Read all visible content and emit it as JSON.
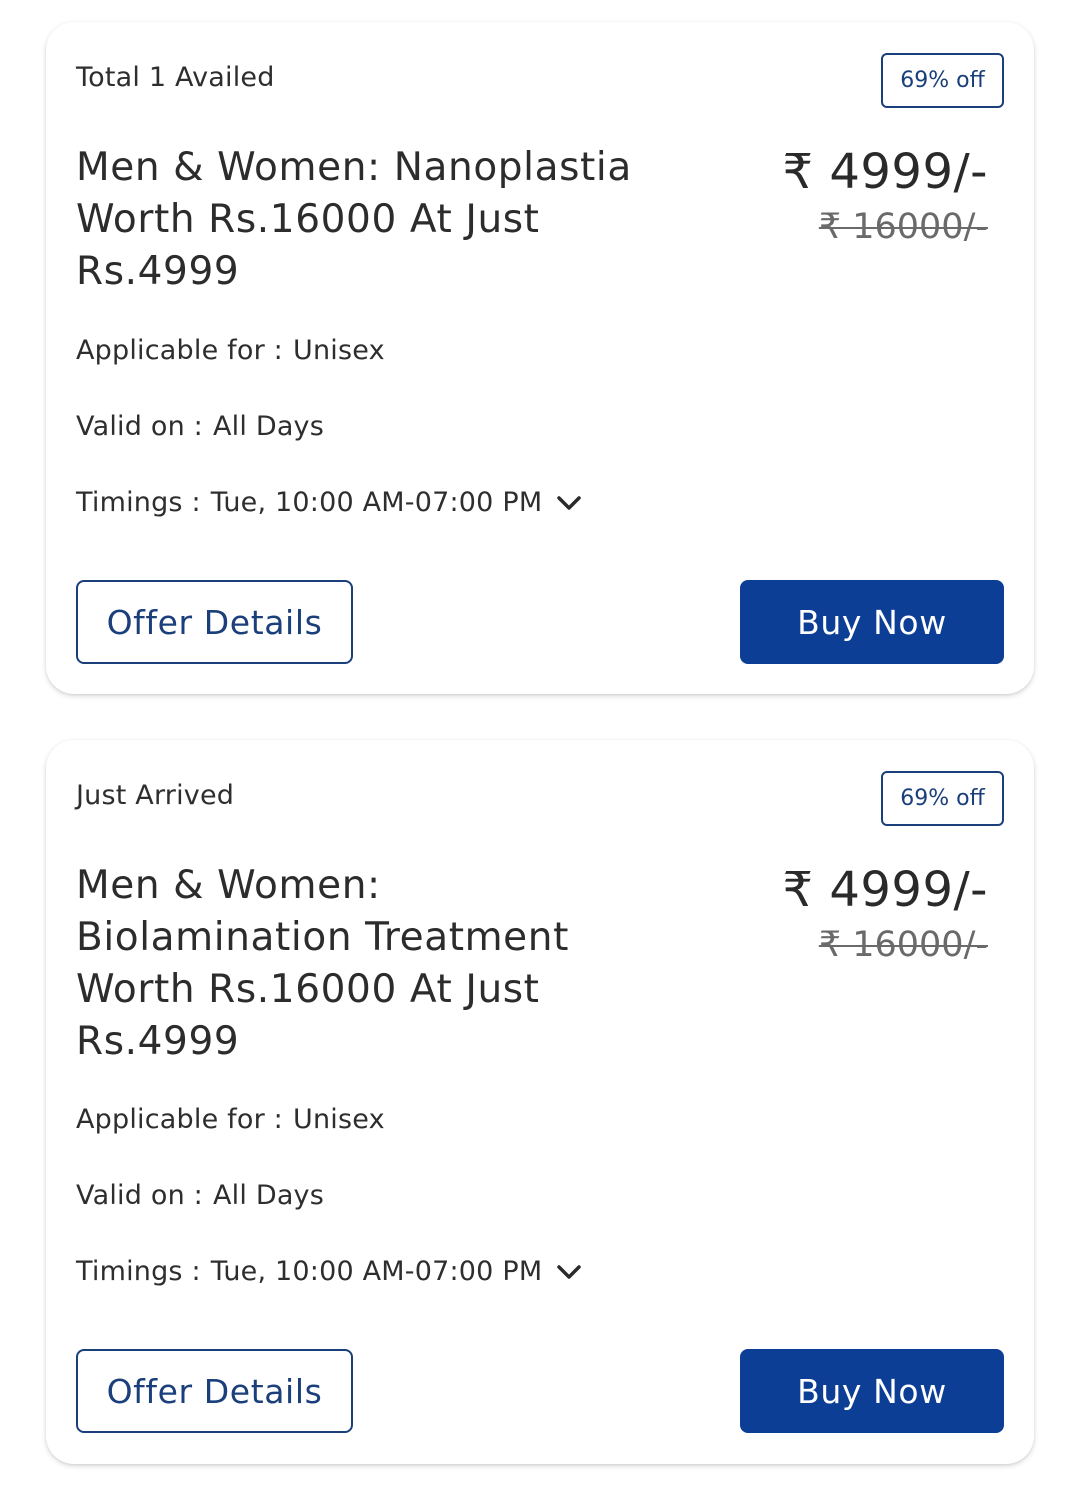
{
  "offers": [
    {
      "status": "Total 1 Availed",
      "discount_badge": "69% off",
      "title": "Men & Women: Nanoplastia Worth Rs.16000 At Just Rs.4999",
      "price_current": "₹ 4999/-",
      "price_original": "₹ 16000/-",
      "applicable_key": "Applicable for :",
      "applicable_value": "Unisex",
      "valid_key": "Valid on :",
      "valid_value": "All Days",
      "timings_key": "Timings :",
      "timings_value": "Tue, 10:00 AM-07:00 PM",
      "details_button": "Offer Details",
      "buy_button": "Buy Now"
    },
    {
      "status": "Just Arrived",
      "discount_badge": "69% off",
      "title": "Men & Women: Biolamination Treatment Worth Rs.16000 At Just Rs.4999",
      "price_current": "₹ 4999/-",
      "price_original": "₹ 16000/-",
      "applicable_key": "Applicable for :",
      "applicable_value": "Unisex",
      "valid_key": "Valid on :",
      "valid_value": "All Days",
      "timings_key": "Timings :",
      "timings_value": "Tue, 10:00 AM-07:00 PM",
      "details_button": "Offer Details",
      "buy_button": "Buy Now"
    }
  ],
  "colors": {
    "primary": "#0c3e96",
    "outline": "#1a3f7a",
    "text": "#2b2b2b"
  },
  "icons": {
    "timings_toggle": "chevron-down-icon"
  }
}
